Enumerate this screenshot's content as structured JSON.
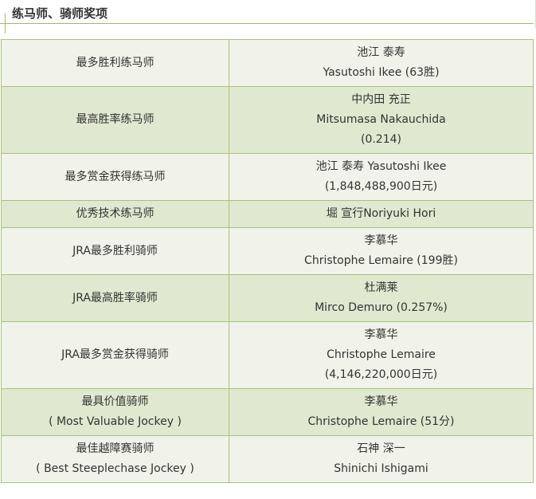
{
  "title": "练马师、骑师奖项",
  "rows": [
    {
      "award": [
        "最多胜利练马师"
      ],
      "winner": [
        "池江 泰寿",
        "Yasutoshi Ikee (63胜)"
      ]
    },
    {
      "award": [
        "最高胜率练马师"
      ],
      "winner": [
        "中内田 充正",
        "Mitsumasa Nakauchida",
        "(0.214)"
      ]
    },
    {
      "award": [
        "最多赏金获得练马师"
      ],
      "winner": [
        "池江 泰寿 Yasutoshi Ikee",
        "(1,848,488,900日元)"
      ]
    },
    {
      "award": [
        "优秀技术练马师"
      ],
      "winner": [
        "堀 宣行Noriyuki Hori"
      ]
    },
    {
      "award": [
        "JRA最多胜利骑师"
      ],
      "winner": [
        "李慕华",
        "Christophe Lemaire (199胜)"
      ]
    },
    {
      "award": [
        "JRA最高胜率骑师"
      ],
      "winner": [
        "杜满莱",
        "Mirco Demuro (0.257%)"
      ]
    },
    {
      "award": [
        "JRA最多赏金获得骑师"
      ],
      "winner": [
        "李慕华",
        "Christophe Lemaire",
        "(4,146,220,000日元)"
      ]
    },
    {
      "award": [
        "最具价值骑师",
        "( Most Valuable Jockey )"
      ],
      "winner": [
        "李慕华",
        "Christophe Lemaire (51分)"
      ]
    },
    {
      "award": [
        "最佳越障赛骑师",
        "( Best Steeplechase Jockey )"
      ],
      "winner": [
        "石神 深一",
        "Shinichi Ishigami"
      ]
    }
  ]
}
